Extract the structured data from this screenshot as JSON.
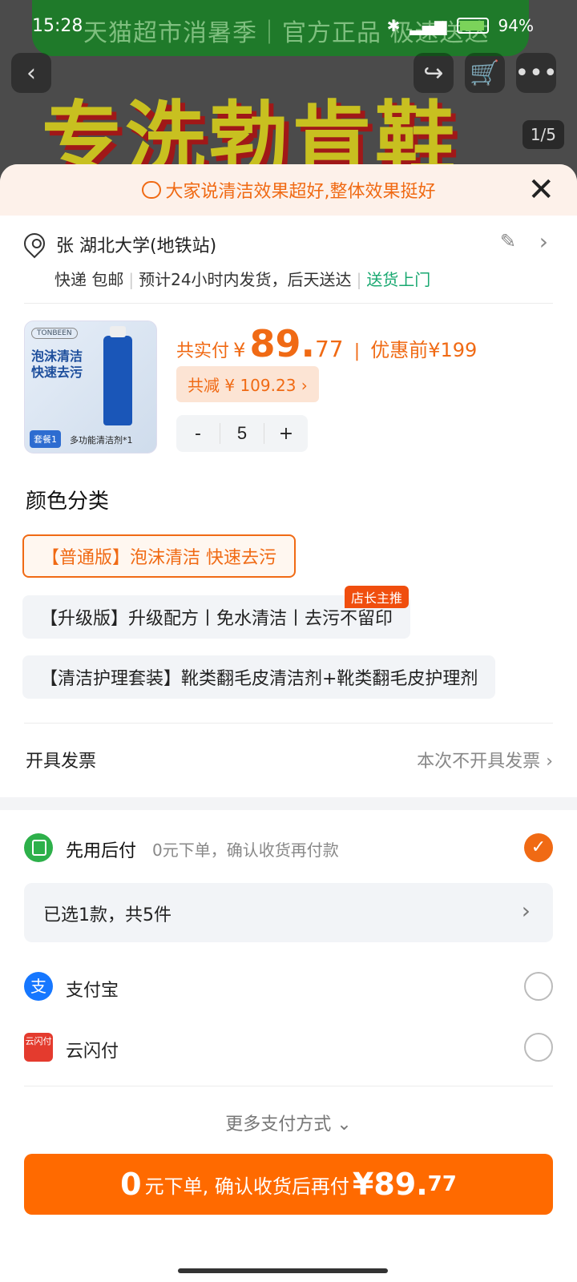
{
  "status_bar": {
    "time": "15:28",
    "battery": "94%"
  },
  "banner": {
    "promo": "天猫超市消暑季｜官方正品 极速送达",
    "headline": "专洗勃肯鞋",
    "page_indicator": "1/5"
  },
  "review_bar": {
    "text": "大家说清洁效果超好,整体效果挺好"
  },
  "address": {
    "name": "张  湖北大学(地铁站)",
    "ship_method": "快递 包邮",
    "ship_time": "预计24小时内发货，后天送达",
    "door": "送货上门"
  },
  "product": {
    "brand": "TONBEEN",
    "thumb_line1": "泡沫清洁",
    "thumb_line2": "快速去污",
    "thumb_tag": "套餐1",
    "thumb_tag_text": "多功能清洁剂*1",
    "paid_label": "共实付",
    "currency": "¥",
    "price_int": "89.",
    "price_cents": "77",
    "orig_label": "优惠前",
    "orig_price": "¥199",
    "discount": "共减 ¥ 109.23 ›",
    "qty_minus": "-",
    "qty": "5",
    "qty_plus": "+"
  },
  "color_section": {
    "title": "颜色分类",
    "options": [
      {
        "label": "【普通版】泡沫清洁 快速去污",
        "selected": true
      },
      {
        "label": "【升级版】升级配方丨免水清洁丨去污不留印",
        "badge": "店长主推"
      },
      {
        "label": "【清洁护理套装】靴类翻毛皮清洁剂+靴类翻毛皮护理剂"
      }
    ]
  },
  "invoice": {
    "label": "开具发票",
    "value": "本次不开具发票"
  },
  "pay_later": {
    "title": "先用后付",
    "desc": "0元下单，确认收货再付款"
  },
  "picked": {
    "text": "已选1款，共5件"
  },
  "payment_methods": [
    {
      "name": "支付宝",
      "icon": "alipay-icon",
      "glyph": "支"
    },
    {
      "name": "云闪付",
      "icon": "unionpay-icon",
      "glyph": "云闪付"
    }
  ],
  "more_payment": "更多支付方式",
  "cta": {
    "zero": "0",
    "mid": "元下单, 确认收货后再付 ",
    "price": "¥89.",
    "cents": "77"
  },
  "colors": {
    "accent": "#f06a14",
    "cta": "#ff6a00",
    "green": "#18a870"
  }
}
